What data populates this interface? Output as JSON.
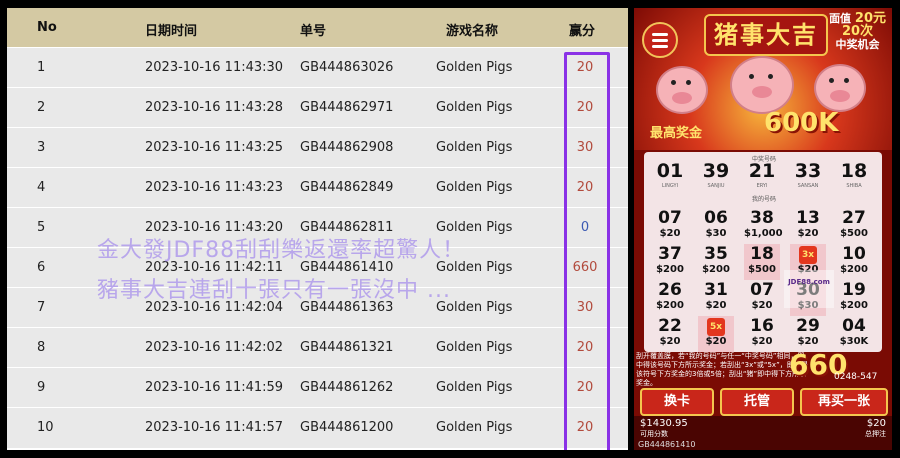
{
  "table": {
    "headers": {
      "no": "No",
      "datetime": "日期时间",
      "order_id": "单号",
      "game_name": "游戏名称",
      "points": "赢分"
    },
    "rows": [
      {
        "no": "1",
        "datetime": "2023-10-16 11:43:30",
        "order_id": "GB444863026",
        "game": "Golden Pigs",
        "points": "20"
      },
      {
        "no": "2",
        "datetime": "2023-10-16 11:43:28",
        "order_id": "GB444862971",
        "game": "Golden Pigs",
        "points": "20"
      },
      {
        "no": "3",
        "datetime": "2023-10-16 11:43:25",
        "order_id": "GB444862908",
        "game": "Golden Pigs",
        "points": "30"
      },
      {
        "no": "4",
        "datetime": "2023-10-16 11:43:23",
        "order_id": "GB444862849",
        "game": "Golden Pigs",
        "points": "20"
      },
      {
        "no": "5",
        "datetime": "2023-10-16 11:43:20",
        "order_id": "GB444862811",
        "game": "Golden Pigs",
        "points": "0"
      },
      {
        "no": "6",
        "datetime": "2023-10-16 11:42:11",
        "order_id": "GB444861410",
        "game": "Golden Pigs",
        "points": "660"
      },
      {
        "no": "7",
        "datetime": "2023-10-16 11:42:04",
        "order_id": "GB444861363",
        "game": "Golden Pigs",
        "points": "30"
      },
      {
        "no": "8",
        "datetime": "2023-10-16 11:42:02",
        "order_id": "GB444861321",
        "game": "Golden Pigs",
        "points": "20"
      },
      {
        "no": "9",
        "datetime": "2023-10-16 11:41:59",
        "order_id": "GB444861262",
        "game": "Golden Pigs",
        "points": "20"
      },
      {
        "no": "10",
        "datetime": "2023-10-16 11:41:57",
        "order_id": "GB444861200",
        "game": "Golden Pigs",
        "points": "20"
      }
    ]
  },
  "overlay": {
    "line1": "金大發JDF88刮刮樂返還率超驚人！",
    "line2": "豬事大吉連刮十張只有一張沒中 ..."
  },
  "game": {
    "title": "猪事大吉",
    "price_label": "面值",
    "price_value": "20元",
    "chances": "20次",
    "chances_label": "中奖机会",
    "top_prize_label": "最高奖金",
    "top_prize_value": "600K",
    "winning_label": "中奖号码",
    "my_numbers_label": "我的号码",
    "winning_numbers": [
      {
        "num": "01",
        "word": "LINGYI"
      },
      {
        "num": "39",
        "word": "SANJIU"
      },
      {
        "num": "21",
        "word": "ERYI"
      },
      {
        "num": "33",
        "word": "SANSAN"
      },
      {
        "num": "18",
        "word": "SHIBA"
      }
    ],
    "my_numbers": [
      {
        "num": "07",
        "prize": "$20"
      },
      {
        "num": "06",
        "prize": "$30"
      },
      {
        "num": "38",
        "prize": "$1,000"
      },
      {
        "num": "13",
        "prize": "$20"
      },
      {
        "num": "27",
        "prize": "$500"
      },
      {
        "num": "37",
        "prize": "$200"
      },
      {
        "num": "35",
        "prize": "$200"
      },
      {
        "num": "18",
        "prize": "$500"
      },
      {
        "num": "",
        "prize": "$20"
      },
      {
        "num": "10",
        "prize": "$200"
      },
      {
        "num": "26",
        "prize": "$200"
      },
      {
        "num": "31",
        "prize": "$20"
      },
      {
        "num": "07",
        "prize": "$20"
      },
      {
        "num": "30",
        "prize": "$30"
      },
      {
        "num": "19",
        "prize": "$200"
      },
      {
        "num": "22",
        "prize": "$20"
      },
      {
        "num": "",
        "prize": "$20"
      },
      {
        "num": "16",
        "prize": "$20"
      },
      {
        "num": "29",
        "prize": "$20"
      },
      {
        "num": "04",
        "prize": "$30K"
      }
    ],
    "multiplier_1": "3x",
    "multiplier_2": "5x",
    "watermark": "JDF88.com",
    "win_amount": "660",
    "serial": "0248-547",
    "instructions": "刮开覆盖膜，若“我的号码”与任一“中奖号码”相同，即中得该号码下方所示奖金；若刮出“3x”或“5x”，即中得该符号下方奖金的3倍或5倍；刮出“猪”即中得下方所示奖金。",
    "btn_exchange": "换卡",
    "btn_auto": "托管",
    "btn_again": "再买一张",
    "balance": "$1430.95",
    "balance_label": "可用分数",
    "bet": "$20",
    "bet_label": "总押注",
    "ticket_id": "GB444861410"
  },
  "colors": {
    "header_bg": "#d4c9a3",
    "row_bg": "#e9e9e9",
    "highlight_border": "#8a32e6",
    "points_red": "#b24a3c",
    "points_blue": "#3a59b2",
    "overlay_text": "#a58ceb"
  }
}
